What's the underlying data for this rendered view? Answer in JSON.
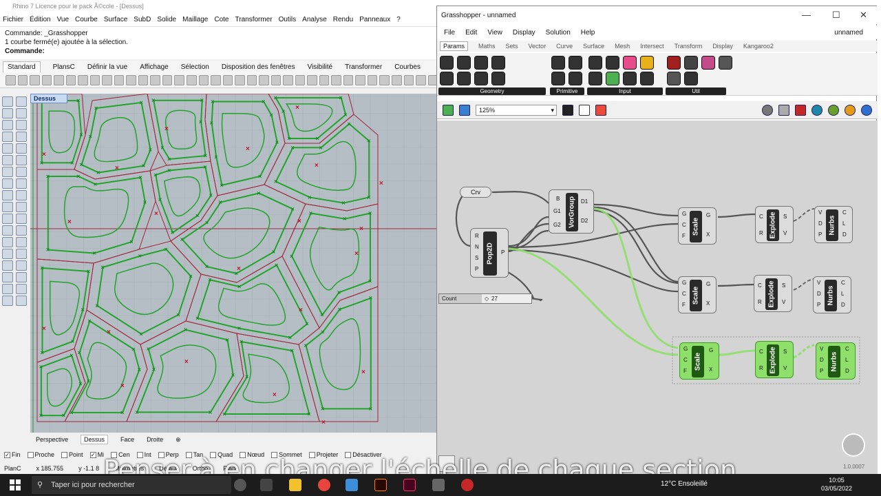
{
  "rhino": {
    "title": "Rhino 7 Licence pour le pack Ã©cole - [Dessus]",
    "menu": [
      "Fichier",
      "Édition",
      "Vue",
      "Courbe",
      "Surface",
      "SubD",
      "Solide",
      "Maillage",
      "Cote",
      "Transformer",
      "Outils",
      "Analyse",
      "Rendu",
      "Panneaux",
      "?"
    ],
    "cmd_line1": "Commande: _Grasshopper",
    "cmd_line2": "1 courbe fermé(e) ajoutée à la sélection.",
    "cmd_prompt": "Commande:",
    "tabs": [
      "Standard",
      "PlansC",
      "Définir la vue",
      "Affichage",
      "Sélection",
      "Disposition des fenêtres",
      "Visibilité",
      "Transformer",
      "Courbes"
    ],
    "viewport_label": "Dessus",
    "viewport_tabs": [
      "Perspective",
      "Dessus",
      "Face",
      "Droite"
    ],
    "osnaps": [
      {
        "label": "Fin",
        "checked": true
      },
      {
        "label": "Proche",
        "checked": false
      },
      {
        "label": "Point",
        "checked": false
      },
      {
        "label": "Mi",
        "checked": true
      },
      {
        "label": "Cen",
        "checked": false
      },
      {
        "label": "Int",
        "checked": false
      },
      {
        "label": "Perp",
        "checked": false
      },
      {
        "label": "Tan",
        "checked": false
      },
      {
        "label": "Quad",
        "checked": false
      },
      {
        "label": "Nœud",
        "checked": false
      },
      {
        "label": "Sommet",
        "checked": false
      },
      {
        "label": "Projeter",
        "checked": false
      },
      {
        "label": "Désactiver",
        "checked": false
      }
    ],
    "status": {
      "plane": "PlanC",
      "x": "x 185.755",
      "y": "y -1.1 8",
      "units": "Millimètres",
      "layer": "Défaut",
      "ortho": "Ortho",
      "plan": "Plan"
    }
  },
  "grasshopper": {
    "title": "Grasshopper - unnamed",
    "doc_name": "unnamed",
    "menu": [
      "File",
      "Edit",
      "View",
      "Display",
      "Solution",
      "Help"
    ],
    "categories": [
      "Params",
      "Maths",
      "Sets",
      "Vector",
      "Curve",
      "Surface",
      "Mesh",
      "Intersect",
      "Transform",
      "Display",
      "Kangaroo2"
    ],
    "groups": [
      "Geometry",
      "Primitive",
      "Input",
      "Util"
    ],
    "zoom": "125%",
    "nodes": {
      "crv": "Crv",
      "pop2d": "Pop2D",
      "vorgroup": "VorGroup",
      "scale": "Scale",
      "explode": "Explode",
      "nurbs": "Nurbs",
      "count_label": "Count",
      "count_value": "27"
    },
    "version": "1.0.0007"
  },
  "subtitle": "Penser à en changer l'échelle de chaque section",
  "taskbar": {
    "search_placeholder": "Taper ici pour rechercher",
    "weather": "12°C  Ensoleillé",
    "time": "10:05",
    "date": "03/05/2022"
  },
  "colors": {
    "curve_green": "#22a32c",
    "voronoi_red": "#a0243a",
    "gh_green": "#8fe06b",
    "grid_bg": "#b6bec5"
  }
}
